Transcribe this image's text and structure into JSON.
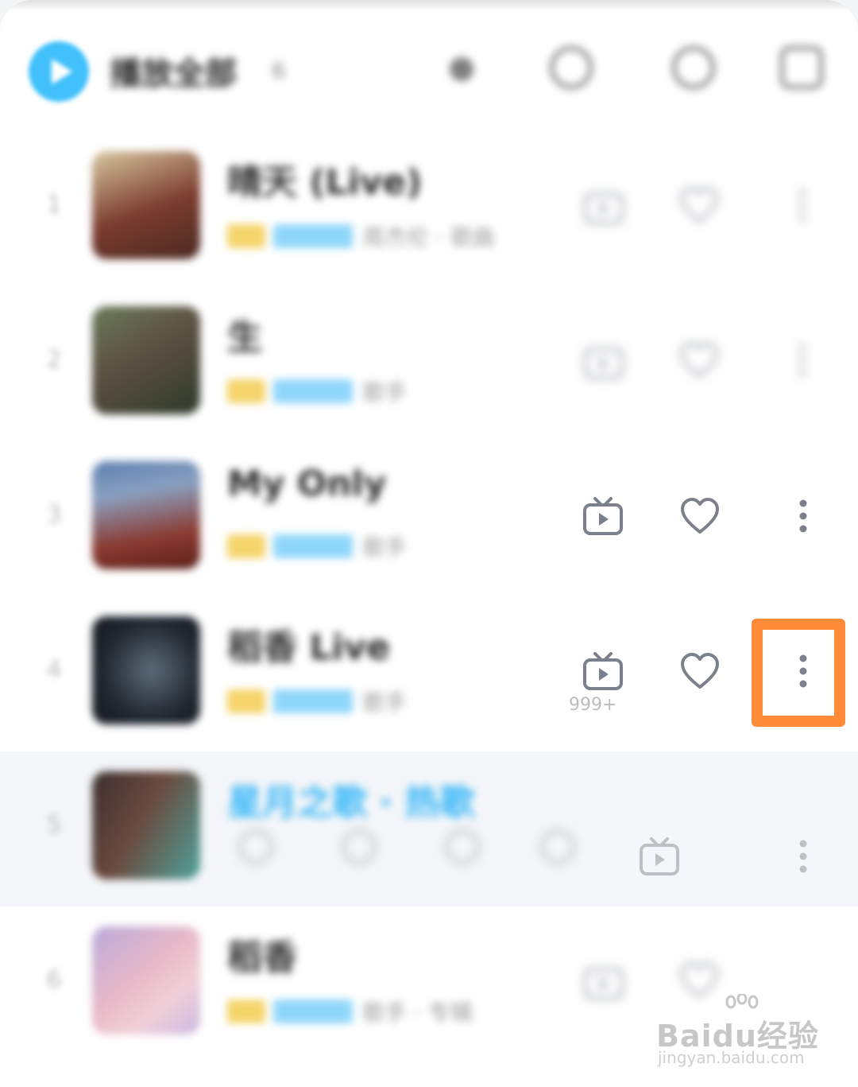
{
  "header": {
    "title": "播放全部",
    "count": "6",
    "icons": [
      "add-icon",
      "download-icon",
      "search-icon",
      "more-icon"
    ]
  },
  "songs": [
    {
      "title": "晴天 (Live)",
      "meta": "周杰伦 · 歌曲",
      "cover_color": "#7a3b2e",
      "cover_color2": "#d8c8a0"
    },
    {
      "title": "生",
      "meta": "歌手",
      "cover_color": "#5b5043",
      "cover_color2": "#2e3a2a"
    },
    {
      "title": "My Only",
      "meta": "歌手",
      "cover_color": "#8a3a30",
      "cover_color2": "#5a7fb0"
    },
    {
      "title": "稻香 Live",
      "meta": "歌手",
      "cover_color": "#202730",
      "cover_color2": "#5d6b78"
    },
    {
      "title": "星月之歌 · 热歌",
      "meta": "",
      "cover_color": "#3a2f2e",
      "cover_color2": "#4ea39a",
      "playing": true,
      "comment_count": "999+"
    },
    {
      "title": "稻香",
      "meta": "歌手 · 专辑",
      "cover_color": "#e8b9c8",
      "cover_color2": "#b9a9d9"
    }
  ],
  "actions": {
    "mv_icon": "tv-play-icon",
    "fav_icon": "heart-icon",
    "more_icon": "vertical-more-icon"
  },
  "highlight_color": "#ff8b38",
  "accent_color": "#41c0fb",
  "watermark": {
    "brand": "Baidu经验",
    "url": "jingyan.baidu.com"
  }
}
